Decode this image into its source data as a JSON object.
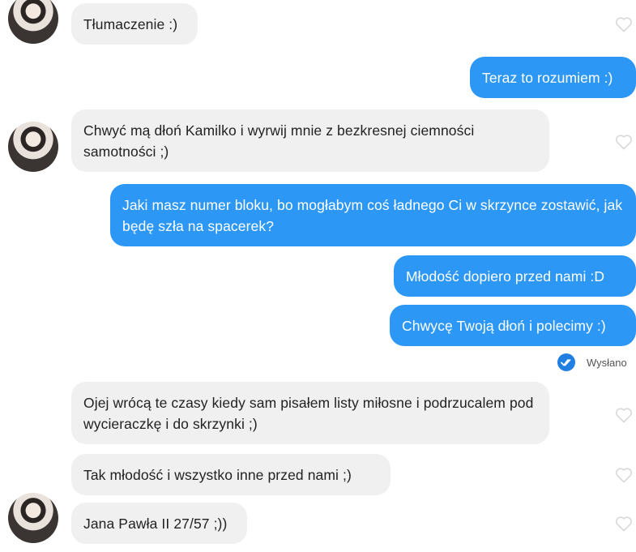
{
  "messages": [
    {
      "side": "in",
      "text": "Tłumaczenie :)"
    },
    {
      "side": "out",
      "text": "Teraz to rozumiem :)"
    },
    {
      "side": "in",
      "text": "Chwyć mą dłoń Kamilko i wyrwij mnie z bezkresnej ciemności samotności ;)"
    },
    {
      "side": "out",
      "text": "Jaki masz numer bloku, bo mogłabym coś ładnego Ci w skrzynce zostawić, jak będę szła na spacerek?"
    },
    {
      "side": "out",
      "text": "Młodość dopiero przed nami :D"
    },
    {
      "side": "out",
      "text": "Chwycę Twoją dłoń i polecimy :)"
    },
    {
      "side": "in",
      "text": "Ojej wrócą te czasy kiedy sam pisałem listy miłosne i podrzucalem pod wycieraczkę i do skrzynki ;)"
    },
    {
      "side": "in",
      "text": "Tak młodość i wszystko inne przed nami ;)"
    },
    {
      "side": "in",
      "text": "Jana Pawła II 27/57 ;))"
    }
  ],
  "status": {
    "label": "Wysłano",
    "icon": "double-check-icon"
  },
  "colors": {
    "outgoing": "#2c97f4",
    "incoming": "#f0f0f0",
    "status_icon": "#1f7fe3"
  }
}
